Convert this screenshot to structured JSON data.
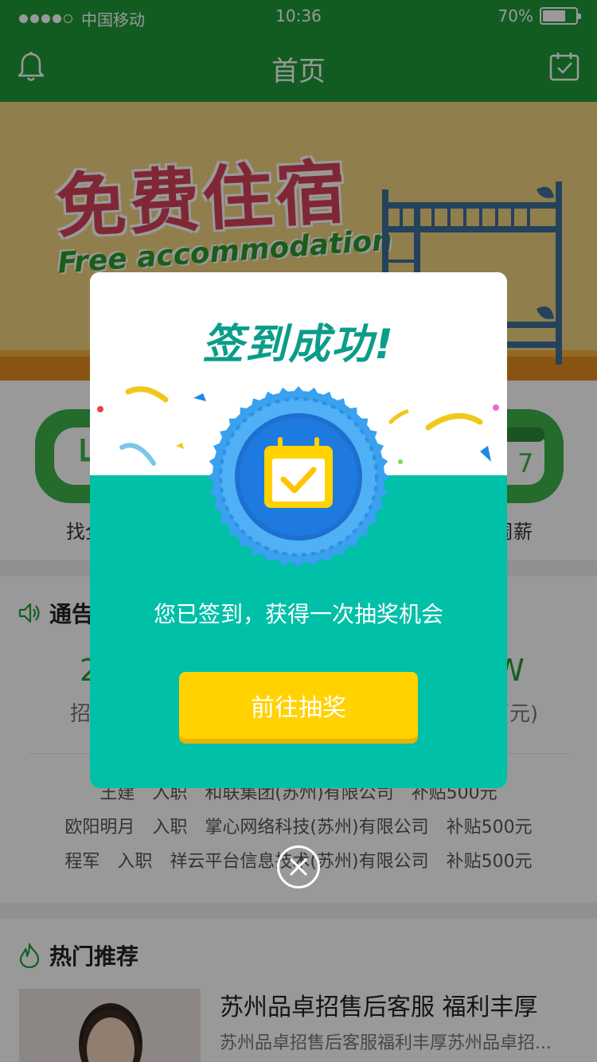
{
  "status_bar": {
    "carrier": "中国移动",
    "time": "10:36",
    "battery": "70%",
    "battery_level": 0.7
  },
  "nav": {
    "title": "首页"
  },
  "banner": {
    "cn_text": "免费住宿",
    "en_text": "Free accommodation"
  },
  "features": [
    {
      "label": "找全"
    },
    {
      "label": "周薪"
    }
  ],
  "notice": {
    "title": "通告",
    "stats": [
      {
        "value": "2",
        "label": "招聘"
      },
      {
        "value": "W",
        "label": "占(元)"
      }
    ],
    "rows": [
      {
        "name": "王建",
        "action": "入职",
        "company": "和联集团(苏州)有限公司",
        "bonus": "补贴500元"
      },
      {
        "name": "欧阳明月",
        "action": "入职",
        "company": "掌心网络科技(苏州)有限公司",
        "bonus": "补贴500元"
      },
      {
        "name": "程军",
        "action": "入职",
        "company": "祥云平台信息技术(苏州)有限公司",
        "bonus": "补贴500元"
      }
    ]
  },
  "hot": {
    "title": "热门推荐",
    "item": {
      "title": "苏州品卓招售后客服 福利丰厚",
      "desc": "苏州品卓招售后客服福利丰厚苏州品卓招..."
    }
  },
  "modal": {
    "title": "签到成功!",
    "message": "您已签到，获得一次抽奖机会",
    "button": "前往抽奖"
  },
  "colors": {
    "primary_green": "#1f9a3a",
    "modal_teal": "#00c0a8",
    "button_yellow": "#ffd200",
    "badge_blue": "#1e88e5"
  }
}
